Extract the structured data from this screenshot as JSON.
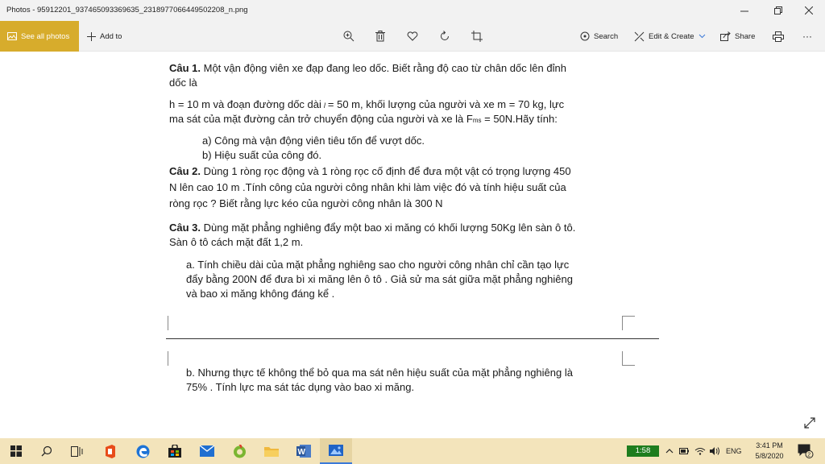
{
  "window": {
    "title": "Photos - 95912201_937465093369635_2318977066449502208_n.png"
  },
  "toolbar": {
    "see_all": "See all photos",
    "add_to": "Add to",
    "search": "Search",
    "edit_create": "Edit & Create",
    "share": "Share",
    "more": "···"
  },
  "document": {
    "q1_label": "Câu 1.",
    "q1_line1": " Một vận động viên xe đạp đang leo dốc. Biết rằng độ cao từ chân dốc lên đỉnh",
    "q1_line2": "dốc là",
    "q1_line3_a": "h = 10 m và đoạn đường dốc dài",
    "q1_l_symbol": "l",
    "q1_line3_b": "= 50 m, khối lượng của người và xe m = 70 kg, lực",
    "q1_line4_a": "ma sát của mặt đường cản trở chuyển động của người và xe là F",
    "q1_ms": "ms",
    "q1_line4_b": " = 50N.Hãy tính:",
    "q1_a": "a)  Công mà vận động viên tiêu tốn để vượt dốc.",
    "q1_b": "b)  Hiệu suất của công đó.",
    "q2_label": "Câu 2.",
    "q2_line1": " Dùng 1 ròng rọc động và 1 ròng rọc cố định để đưa một vật có trọng lượng 450",
    "q2_line2": "N lên cao 10 m .Tính công của người công nhân khi làm việc đó và tính hiệu suất của",
    "q2_line3": "ròng rọc ? Biết rằng lực kéo của người công nhân là 300 N",
    "q3_label": "Câu 3.",
    "q3_line1": " Dùng mặt phẳng nghiêng đẩy một bao xi măng có khối lượng 50Kg lên sàn ô tô.",
    "q3_line2": "Sàn ô tô cách mặt đất 1,2 m.",
    "q3_a_line1": "a. Tính chiều dài của mặt phẳng nghiêng sao cho người công nhân chỉ cần tạo lực",
    "q3_a_line2": "đẩy bằng 200N để đưa bì xi măng lên ô tô . Giả sử ma sát giữa mặt phẳng nghiêng",
    "q3_a_line3": "và bao xi măng không đáng kể .",
    "q3_b_line1": "b. Nhưng thực tế không thể bỏ qua ma sát nên hiệu suất của mặt phẳng nghiêng là",
    "q3_b_line2": "75% . Tính lực ma sát tác dụng vào bao xi măng."
  },
  "taskbar": {
    "badge": "1:58",
    "lang": "ENG",
    "time": "3:41 PM",
    "date": "5/8/2020",
    "notifications": "2"
  },
  "colors": {
    "accent": "#d7ac2c",
    "taskbar": "#f3e4bb",
    "badge": "#1e7d1e"
  }
}
